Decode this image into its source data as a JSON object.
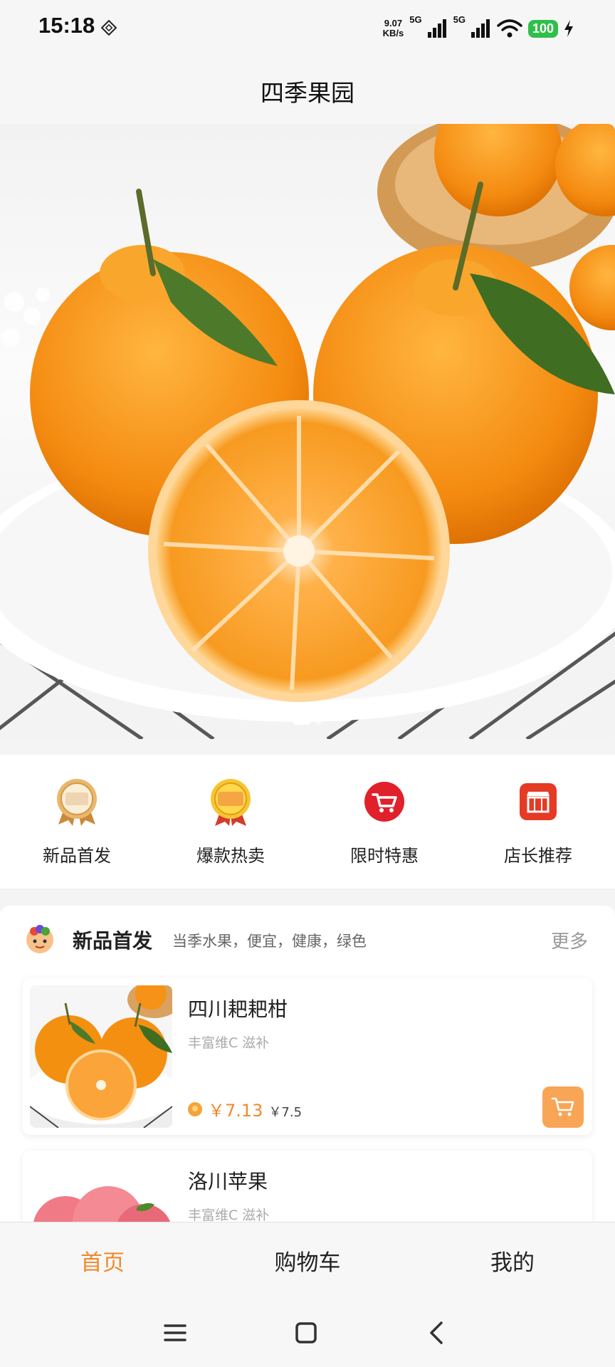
{
  "status_bar": {
    "time": "15:18",
    "net_speed_value": "9.07",
    "net_speed_unit": "KB/s",
    "signal_1_label": "5G",
    "signal_2_label": "5G",
    "battery": "100"
  },
  "header": {
    "title": "四季果园"
  },
  "banner": {
    "slide_count": 2,
    "active_slide": 1
  },
  "categories": [
    {
      "label": "新品首发",
      "icon": "new-product-medal-icon"
    },
    {
      "label": "爆款热卖",
      "icon": "hot-sale-badge-icon"
    },
    {
      "label": "限时特惠",
      "icon": "limited-offer-cart-icon"
    },
    {
      "label": "店长推荐",
      "icon": "store-recommend-icon"
    }
  ],
  "section": {
    "title": "新品首发",
    "subtitle": "当季水果，便宜，健康，绿色",
    "more_label": "更多"
  },
  "products": [
    {
      "name": "四川耙耙柑",
      "desc": "丰富维C 滋补",
      "price_current": "￥7.13",
      "price_original": "￥7.5"
    },
    {
      "name": "洛川苹果",
      "desc": "丰富维C 滋补"
    }
  ],
  "tabs": [
    {
      "label": "首页",
      "active": true
    },
    {
      "label": "购物车",
      "active": false
    },
    {
      "label": "我的",
      "active": false
    }
  ],
  "colors": {
    "accent": "#f08a2d",
    "cart_button": "#f9a556",
    "battery": "#2fbf4a"
  }
}
